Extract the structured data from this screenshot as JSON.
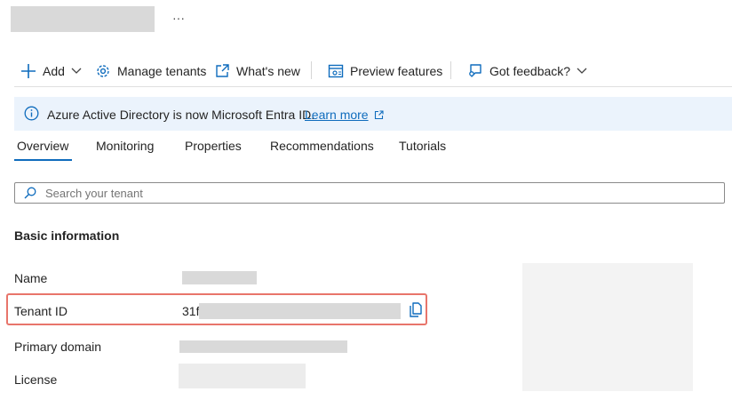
{
  "header": {
    "more_glyph": "···"
  },
  "toolbar": {
    "add_label": "Add",
    "manage_tenants_label": "Manage tenants",
    "whats_new_label": "What's new",
    "preview_features_label": "Preview features",
    "feedback_label": "Got feedback?"
  },
  "banner": {
    "message": "Azure Active Directory is now Microsoft Entra ID.",
    "link_label": "Learn more"
  },
  "tabs": [
    {
      "label": "Overview",
      "active": true
    },
    {
      "label": "Monitoring"
    },
    {
      "label": "Properties"
    },
    {
      "label": "Recommendations"
    },
    {
      "label": "Tutorials"
    }
  ],
  "search": {
    "placeholder": "Search your tenant"
  },
  "basic_info": {
    "heading": "Basic information",
    "rows": [
      {
        "label": "Name"
      },
      {
        "label": "Tenant ID",
        "value_prefix": "31f"
      },
      {
        "label": "Primary domain"
      },
      {
        "label": "License"
      }
    ]
  },
  "colors": {
    "accent": "#0f6cbd",
    "banner_bg": "#ebf3fc",
    "highlight": "#e8756b",
    "redaction": "#d9d9d9"
  }
}
